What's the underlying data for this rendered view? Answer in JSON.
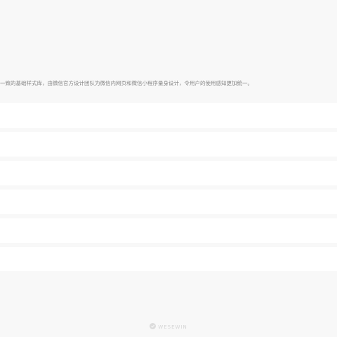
{
  "intro": {
    "text": "一致的基础样式库，由微信官方设计团队为微信内网页和微信小程序量身设计，令用户的使用感知更加统一。"
  },
  "list": {
    "rows": [
      {
        "label": ""
      },
      {
        "label": ""
      },
      {
        "label": ""
      },
      {
        "label": ""
      },
      {
        "label": ""
      },
      {
        "label": ""
      }
    ]
  },
  "footer": {
    "brand": "WESEWIN",
    "icon": "weui-logo-icon"
  },
  "colors": {
    "page_background": "#f8f8f8",
    "row_background": "#ffffff",
    "intro_text": "#888888",
    "footer_text": "#d5d5d5"
  }
}
